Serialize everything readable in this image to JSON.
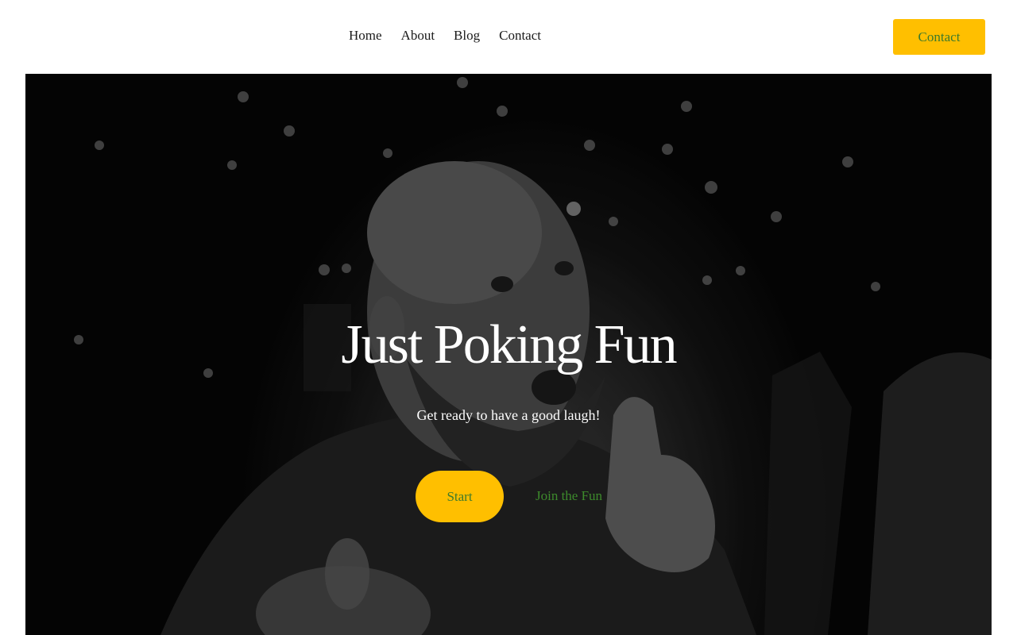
{
  "nav": {
    "items": [
      {
        "label": "Home"
      },
      {
        "label": "About"
      },
      {
        "label": "Blog"
      },
      {
        "label": "Contact"
      }
    ],
    "cta_label": "Contact"
  },
  "hero": {
    "title": "Just Poking Fun",
    "subtitle": "Get ready to have a good laugh!",
    "primary_button": "Start",
    "secondary_link": "Join the Fun",
    "image_icon": "photo-man-thumbs-up"
  },
  "colors": {
    "accent": "#ffbf00",
    "link_green": "#3d7a2c",
    "text_dark": "#1a1a1a",
    "hero_bg": "#000000"
  }
}
